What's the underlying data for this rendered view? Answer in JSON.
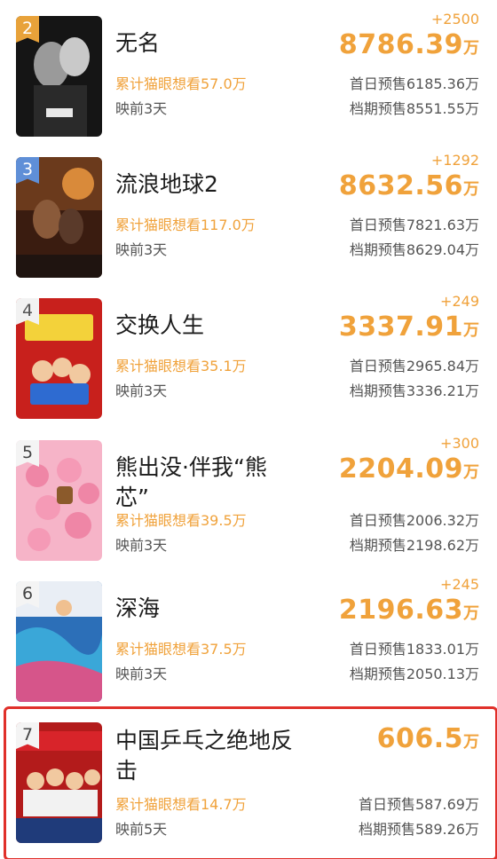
{
  "unit": "万",
  "colors": {
    "accent": "#f0a23b",
    "highlight_border": "#e0302a"
  },
  "movies": [
    {
      "rank": "2",
      "title": "无名",
      "delta": "+2500",
      "gross": "8786.39",
      "want": "累计猫眼想看57.0万",
      "release": "映前3天",
      "first_day": "首日预售6185.36万",
      "period": "档期预售8551.55万"
    },
    {
      "rank": "3",
      "title": "流浪地球2",
      "delta": "+1292",
      "gross": "8632.56",
      "want": "累计猫眼想看117.0万",
      "release": "映前3天",
      "first_day": "首日预售7821.63万",
      "period": "档期预售8629.04万"
    },
    {
      "rank": "4",
      "title": "交换人生",
      "delta": "+249",
      "gross": "3337.91",
      "want": "累计猫眼想看35.1万",
      "release": "映前3天",
      "first_day": "首日预售2965.84万",
      "period": "档期预售3336.21万"
    },
    {
      "rank": "5",
      "title": "熊出没·伴我“熊芯”",
      "delta": "+300",
      "gross": "2204.09",
      "want": "累计猫眼想看39.5万",
      "release": "映前3天",
      "first_day": "首日预售2006.32万",
      "period": "档期预售2198.62万"
    },
    {
      "rank": "6",
      "title": "深海",
      "delta": "+245",
      "gross": "2196.63",
      "want": "累计猫眼想看37.5万",
      "release": "映前3天",
      "first_day": "首日预售1833.01万",
      "period": "档期预售2050.13万"
    },
    {
      "rank": "7",
      "title": "中国乒乓之绝地反击",
      "delta": "",
      "gross": "606.5",
      "want": "累计猫眼想看14.7万",
      "release": "映前5天",
      "first_day": "首日预售587.69万",
      "period": "档期预售589.26万"
    }
  ]
}
